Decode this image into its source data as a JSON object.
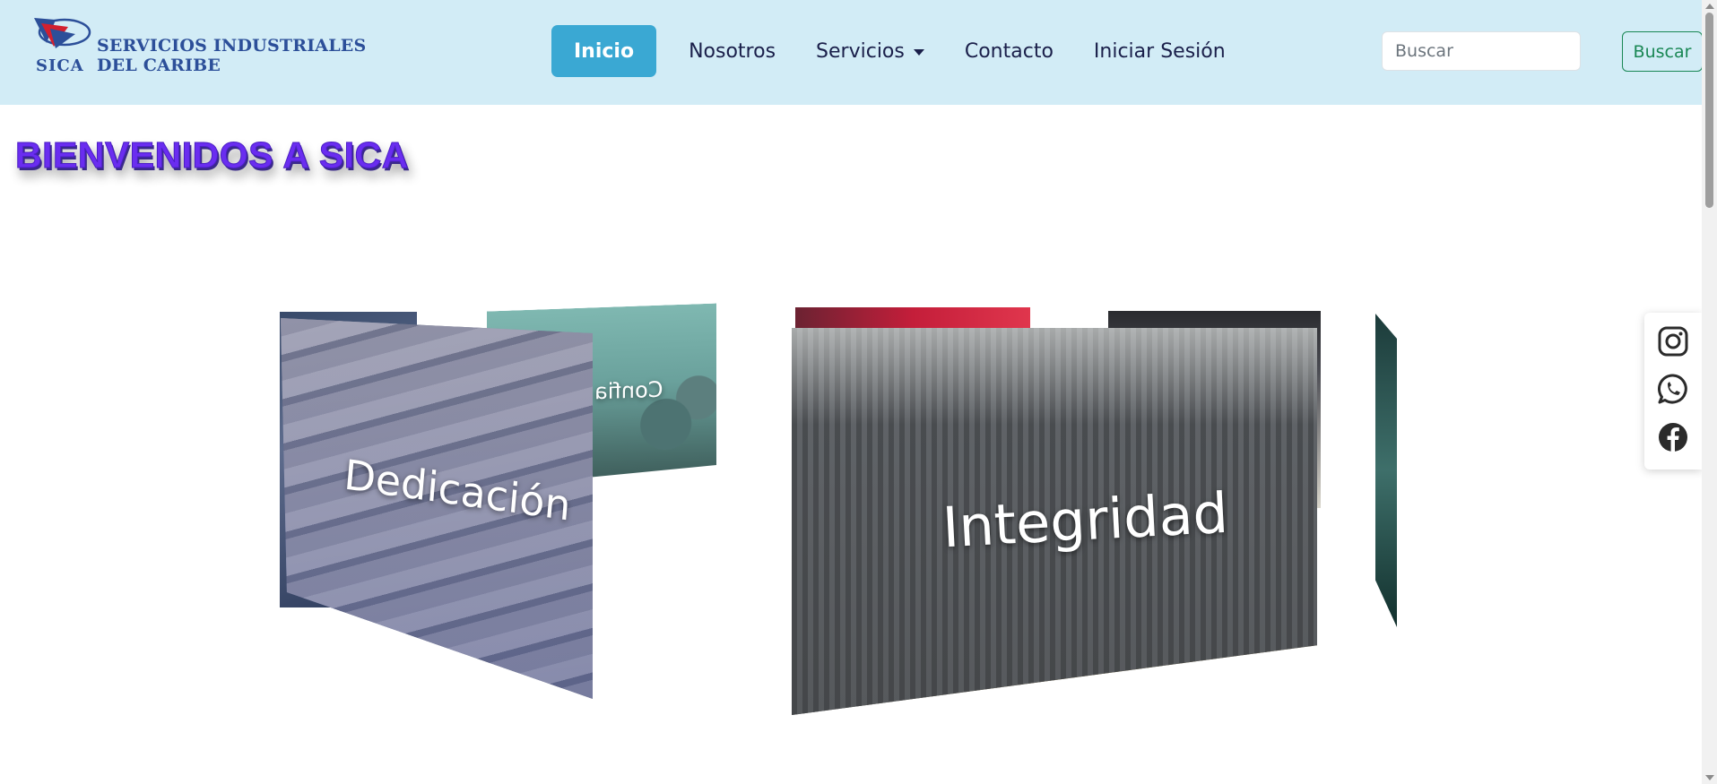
{
  "brand": {
    "line1": "SERVICIOS INDUSTRIALES",
    "line2": "DEL CARIBE",
    "short": "SICA",
    "logo_icon": "sica-flag-logo"
  },
  "nav": {
    "items": [
      {
        "label": "Inicio",
        "active": true
      },
      {
        "label": "Nosotros"
      },
      {
        "label": "Servicios",
        "dropdown": true
      },
      {
        "label": "Contacto"
      },
      {
        "label": "Iniciar Sesión"
      }
    ]
  },
  "search": {
    "placeholder": "Buscar",
    "button_label": "Buscar"
  },
  "main": {
    "title": "BIENVENIDOS A SICA"
  },
  "carousel": {
    "slides": [
      {
        "caption": "Dedicación"
      },
      {
        "caption": "Confia"
      },
      {
        "caption": "Integridad"
      }
    ]
  },
  "social": {
    "icons": [
      "instagram-icon",
      "whatsapp-icon",
      "facebook-icon"
    ]
  },
  "colors": {
    "navbar_bg": "#d2ecf6",
    "active_nav": "#3aa8d3",
    "title": "#6a2df0",
    "search_button": "#198754",
    "brand": "#2c4f99"
  }
}
